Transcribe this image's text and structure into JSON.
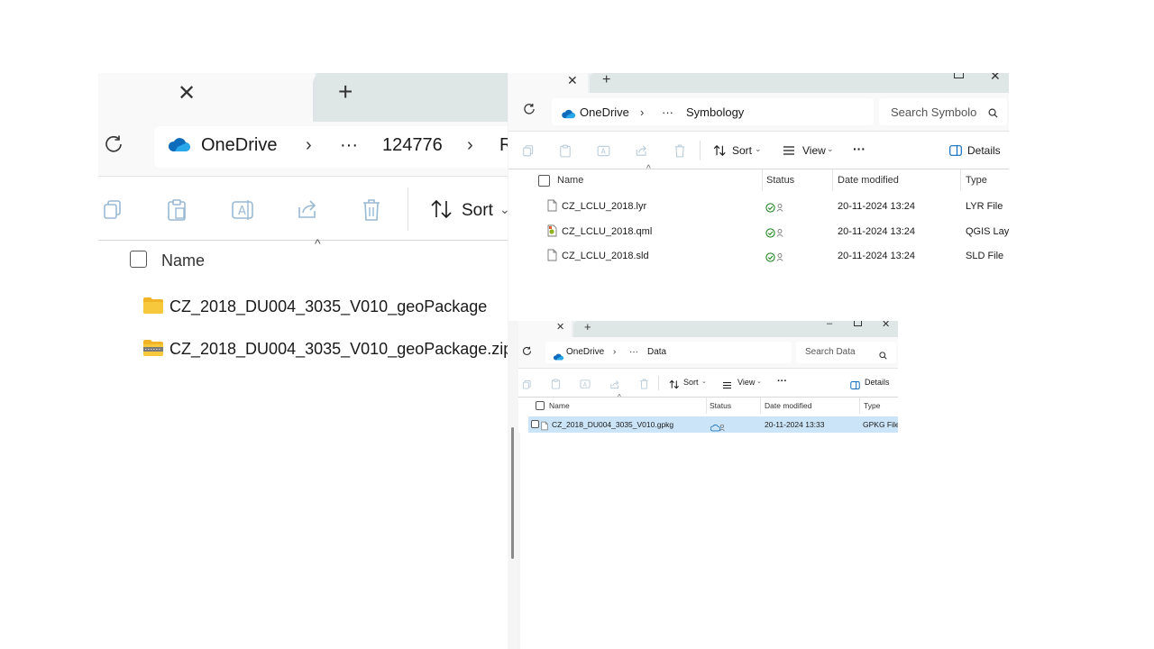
{
  "window1": {
    "tab_close": "✕",
    "new_tab": "+",
    "breadcrumb": [
      "OneDrive",
      "···",
      "124776",
      "R"
    ],
    "toolbar": {
      "sort_label": "Sort"
    },
    "list_header": {
      "name": "Name"
    },
    "files": [
      {
        "name": "CZ_2018_DU004_3035_V010_geoPackage",
        "icon": "folder-icon"
      },
      {
        "name": "CZ_2018_DU004_3035_V010_geoPackage.zip",
        "icon": "zip-folder-icon"
      }
    ]
  },
  "window2": {
    "tab_close": "✕",
    "new_tab": "+",
    "breadcrumb": [
      "OneDrive",
      "···",
      "Symbology"
    ],
    "search_placeholder": "Search Symbolo",
    "toolbar": {
      "sort_label": "Sort",
      "view_label": "View",
      "more_label": "···",
      "details_label": "Details"
    },
    "columns": {
      "name": "Name",
      "status": "Status",
      "date_modified": "Date modified",
      "type": "Type"
    },
    "files": [
      {
        "name": "CZ_LCLU_2018.lyr",
        "date_modified": "20-11-2024 13:24",
        "type": "LYR File",
        "icon": "file-icon"
      },
      {
        "name": "CZ_LCLU_2018.qml",
        "date_modified": "20-11-2024 13:24",
        "type": "QGIS Laye",
        "icon": "qgis-file-icon"
      },
      {
        "name": "CZ_LCLU_2018.sld",
        "date_modified": "20-11-2024 13:24",
        "type": "SLD File",
        "icon": "file-icon"
      }
    ]
  },
  "window3": {
    "tab_close": "✕",
    "new_tab": "+",
    "breadcrumb": [
      "OneDrive",
      "···",
      "Data"
    ],
    "search_placeholder": "Search Data",
    "toolbar": {
      "sort_label": "Sort",
      "view_label": "View",
      "more_label": "···",
      "details_label": "Details"
    },
    "columns": {
      "name": "Name",
      "status": "Status",
      "date_modified": "Date modified",
      "type": "Type"
    },
    "files": [
      {
        "name": "CZ_2018_DU004_3035_V010.gpkg",
        "date_modified": "20-11-2024 13:33",
        "type": "GPKG File",
        "icon": "file-icon"
      }
    ]
  },
  "colors": {
    "onedrive_blue": "#0f6cbd",
    "synced_green": "#107c10",
    "selection": "#cce4f7",
    "folder_yellow": "#f8c83c"
  }
}
